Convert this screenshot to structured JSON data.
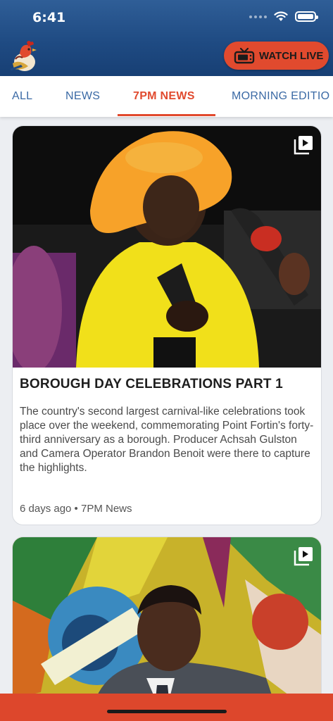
{
  "status_bar": {
    "time": "6:41"
  },
  "header": {
    "logo_icon": "rooster-logo-icon",
    "watch_live_label": "WATCH LIVE",
    "watch_live_icon": "tv-icon",
    "accent_color": "#e14a2e"
  },
  "tabs": [
    {
      "label": "ALL",
      "active": false
    },
    {
      "label": "NEWS",
      "active": false
    },
    {
      "label": "7PM NEWS",
      "active": true
    },
    {
      "label": "MORNING EDITIO",
      "active": false
    }
  ],
  "cards": [
    {
      "title": "BOROUGH DAY CELEBRATIONS PART 1",
      "description": "The country's second largest carnival-like celebrations took place over the weekend, commemorating Point Fortin's forty-third anniversary as a borough. Producer Achsah Gulston and Camera Operator Brandon Benoit were there to capture the highlights.",
      "meta": "6 days ago • 7PM News",
      "media_icon": "video-playlist-icon"
    },
    {
      "title": "",
      "description": "",
      "meta": "",
      "media_icon": "video-playlist-icon"
    }
  ]
}
